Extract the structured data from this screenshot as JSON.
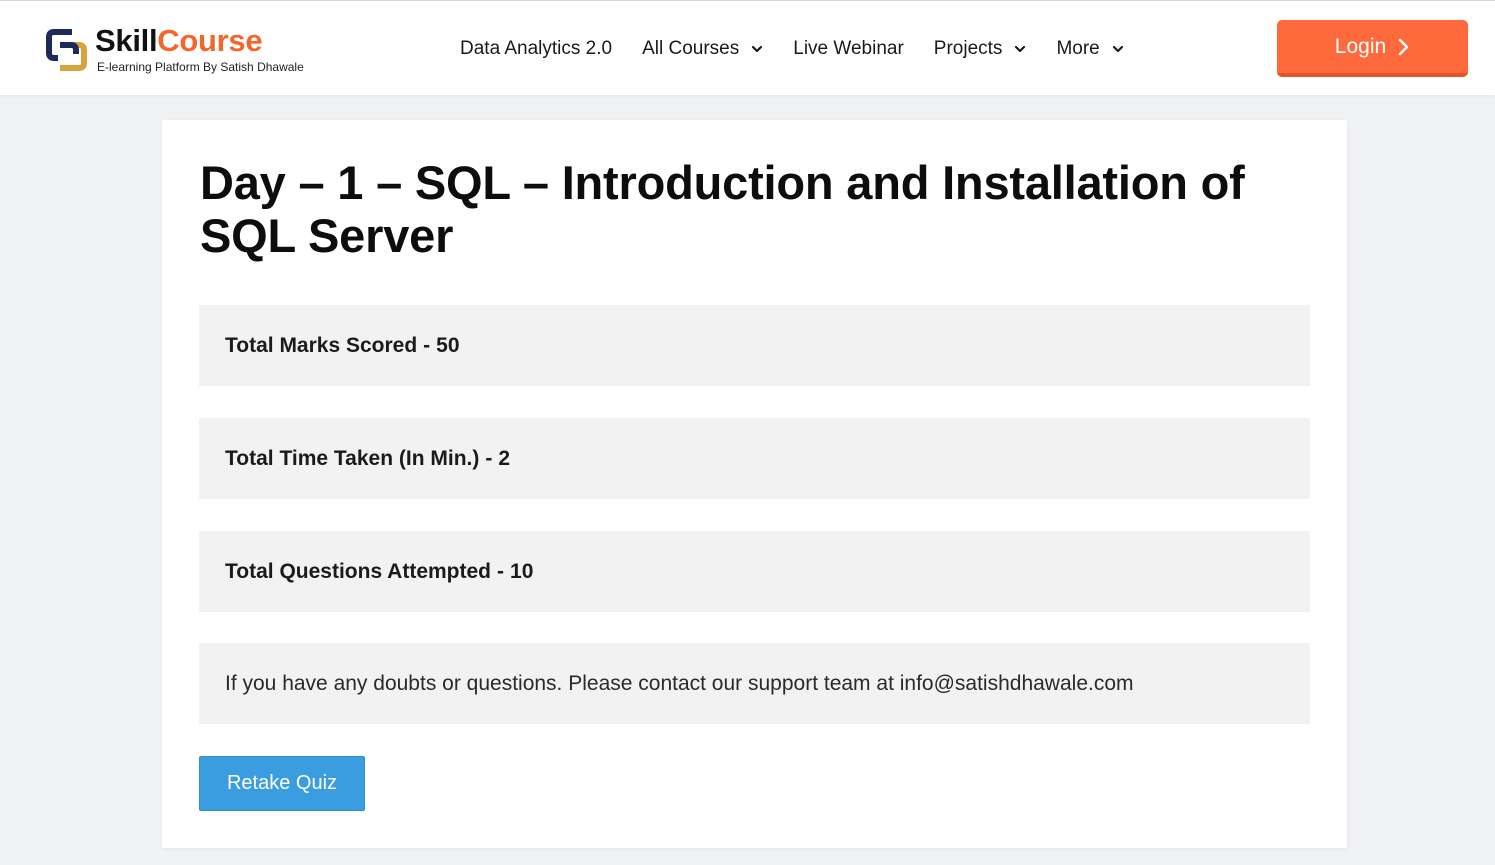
{
  "header": {
    "brand_skill": "Skill",
    "brand_course": "Course",
    "tagline": "E-learning Platform By Satish Dhawale",
    "nav": [
      {
        "label": "Data Analytics 2.0",
        "dropdown": false
      },
      {
        "label": "All Courses",
        "dropdown": true
      },
      {
        "label": "Live Webinar",
        "dropdown": false
      },
      {
        "label": "Projects",
        "dropdown": true
      },
      {
        "label": "More",
        "dropdown": true
      }
    ],
    "login_label": "Login"
  },
  "main": {
    "title": "Day – 1 – SQL – Introduction and Installation of SQL Server",
    "stats": [
      {
        "label": "Total Marks Scored",
        "value": "50"
      },
      {
        "label": "Total Time Taken (In Min.)",
        "value": "2"
      },
      {
        "label": "Total Questions Attempted",
        "value": "10"
      }
    ],
    "support_note": "If you have any doubts or questions. Please contact our support team at info@satishdhawale.com",
    "retake_label": "Retake Quiz"
  },
  "colors": {
    "accent": "#ff6a3d",
    "brand_orange": "#f2672e",
    "brand_navy": "#1f2a5a",
    "brand_gold": "#d9a23a",
    "button_blue": "#3a9de0"
  },
  "icons": {
    "logo": "skillcourse-logo-icon",
    "dropdown": "chevron-down-icon",
    "login_arrow": "chevron-right-icon"
  }
}
